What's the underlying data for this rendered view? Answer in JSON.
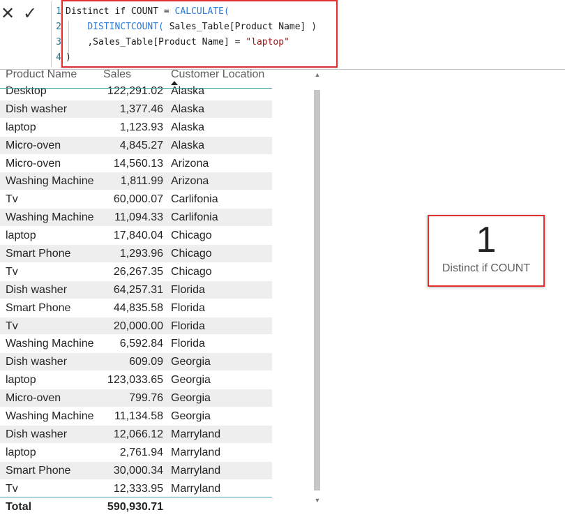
{
  "formula_bar": {
    "cancel_icon": "close-icon",
    "commit_icon": "checkmark-icon",
    "line_numbers": [
      "1",
      "2",
      "3",
      "4"
    ],
    "code": {
      "line1_name": "Distinct if COUNT = ",
      "line1_fn": "CALCULATE(",
      "line2_fn": "DISTINCTCOUNT(",
      "line2_rest": " Sales_Table[Product Name] )",
      "line3_rest": ",Sales_Table[Product Name] = ",
      "line3_str": "\"laptop\"",
      "line4": ")"
    }
  },
  "table": {
    "headers": {
      "product": "Product Name",
      "sales": "Sales",
      "location": "Customer Location"
    },
    "sort_column": "Customer Location",
    "rows": [
      [
        "Desktop",
        "122,291.02",
        "Alaska"
      ],
      [
        "Dish washer",
        "1,377.46",
        "Alaska"
      ],
      [
        "laptop",
        "1,123.93",
        "Alaska"
      ],
      [
        "Micro-oven",
        "4,845.27",
        "Alaska"
      ],
      [
        "Micro-oven",
        "14,560.13",
        "Arizona"
      ],
      [
        "Washing Machine",
        "1,811.99",
        "Arizona"
      ],
      [
        "Tv",
        "60,000.07",
        "Carlifonia"
      ],
      [
        "Washing Machine",
        "11,094.33",
        "Carlifonia"
      ],
      [
        "laptop",
        "17,840.04",
        "Chicago"
      ],
      [
        "Smart Phone",
        "1,293.96",
        "Chicago"
      ],
      [
        "Tv",
        "26,267.35",
        "Chicago"
      ],
      [
        "Dish washer",
        "64,257.31",
        "Florida"
      ],
      [
        "Smart Phone",
        "44,835.58",
        "Florida"
      ],
      [
        "Tv",
        "20,000.00",
        "Florida"
      ],
      [
        "Washing Machine",
        "6,592.84",
        "Florida"
      ],
      [
        "Dish washer",
        "609.09",
        "Georgia"
      ],
      [
        "laptop",
        "123,033.65",
        "Georgia"
      ],
      [
        "Micro-oven",
        "799.76",
        "Georgia"
      ],
      [
        "Washing Machine",
        "11,134.58",
        "Georgia"
      ],
      [
        "Dish washer",
        "12,066.12",
        "Marryland"
      ],
      [
        "laptop",
        "2,761.94",
        "Marryland"
      ],
      [
        "Smart Phone",
        "30,000.34",
        "Marryland"
      ],
      [
        "Tv",
        "12,333.95",
        "Marryland"
      ]
    ],
    "total": {
      "label": "Total",
      "sales": "590,930.71"
    }
  },
  "card": {
    "value": "1",
    "label": "Distinct if COUNT"
  },
  "colors": {
    "highlight_border": "#e03030",
    "row_alt": "#eeeeee",
    "header_line": "#41a5b0",
    "dax_function": "#2a7ad6",
    "dax_string": "#a31515"
  }
}
